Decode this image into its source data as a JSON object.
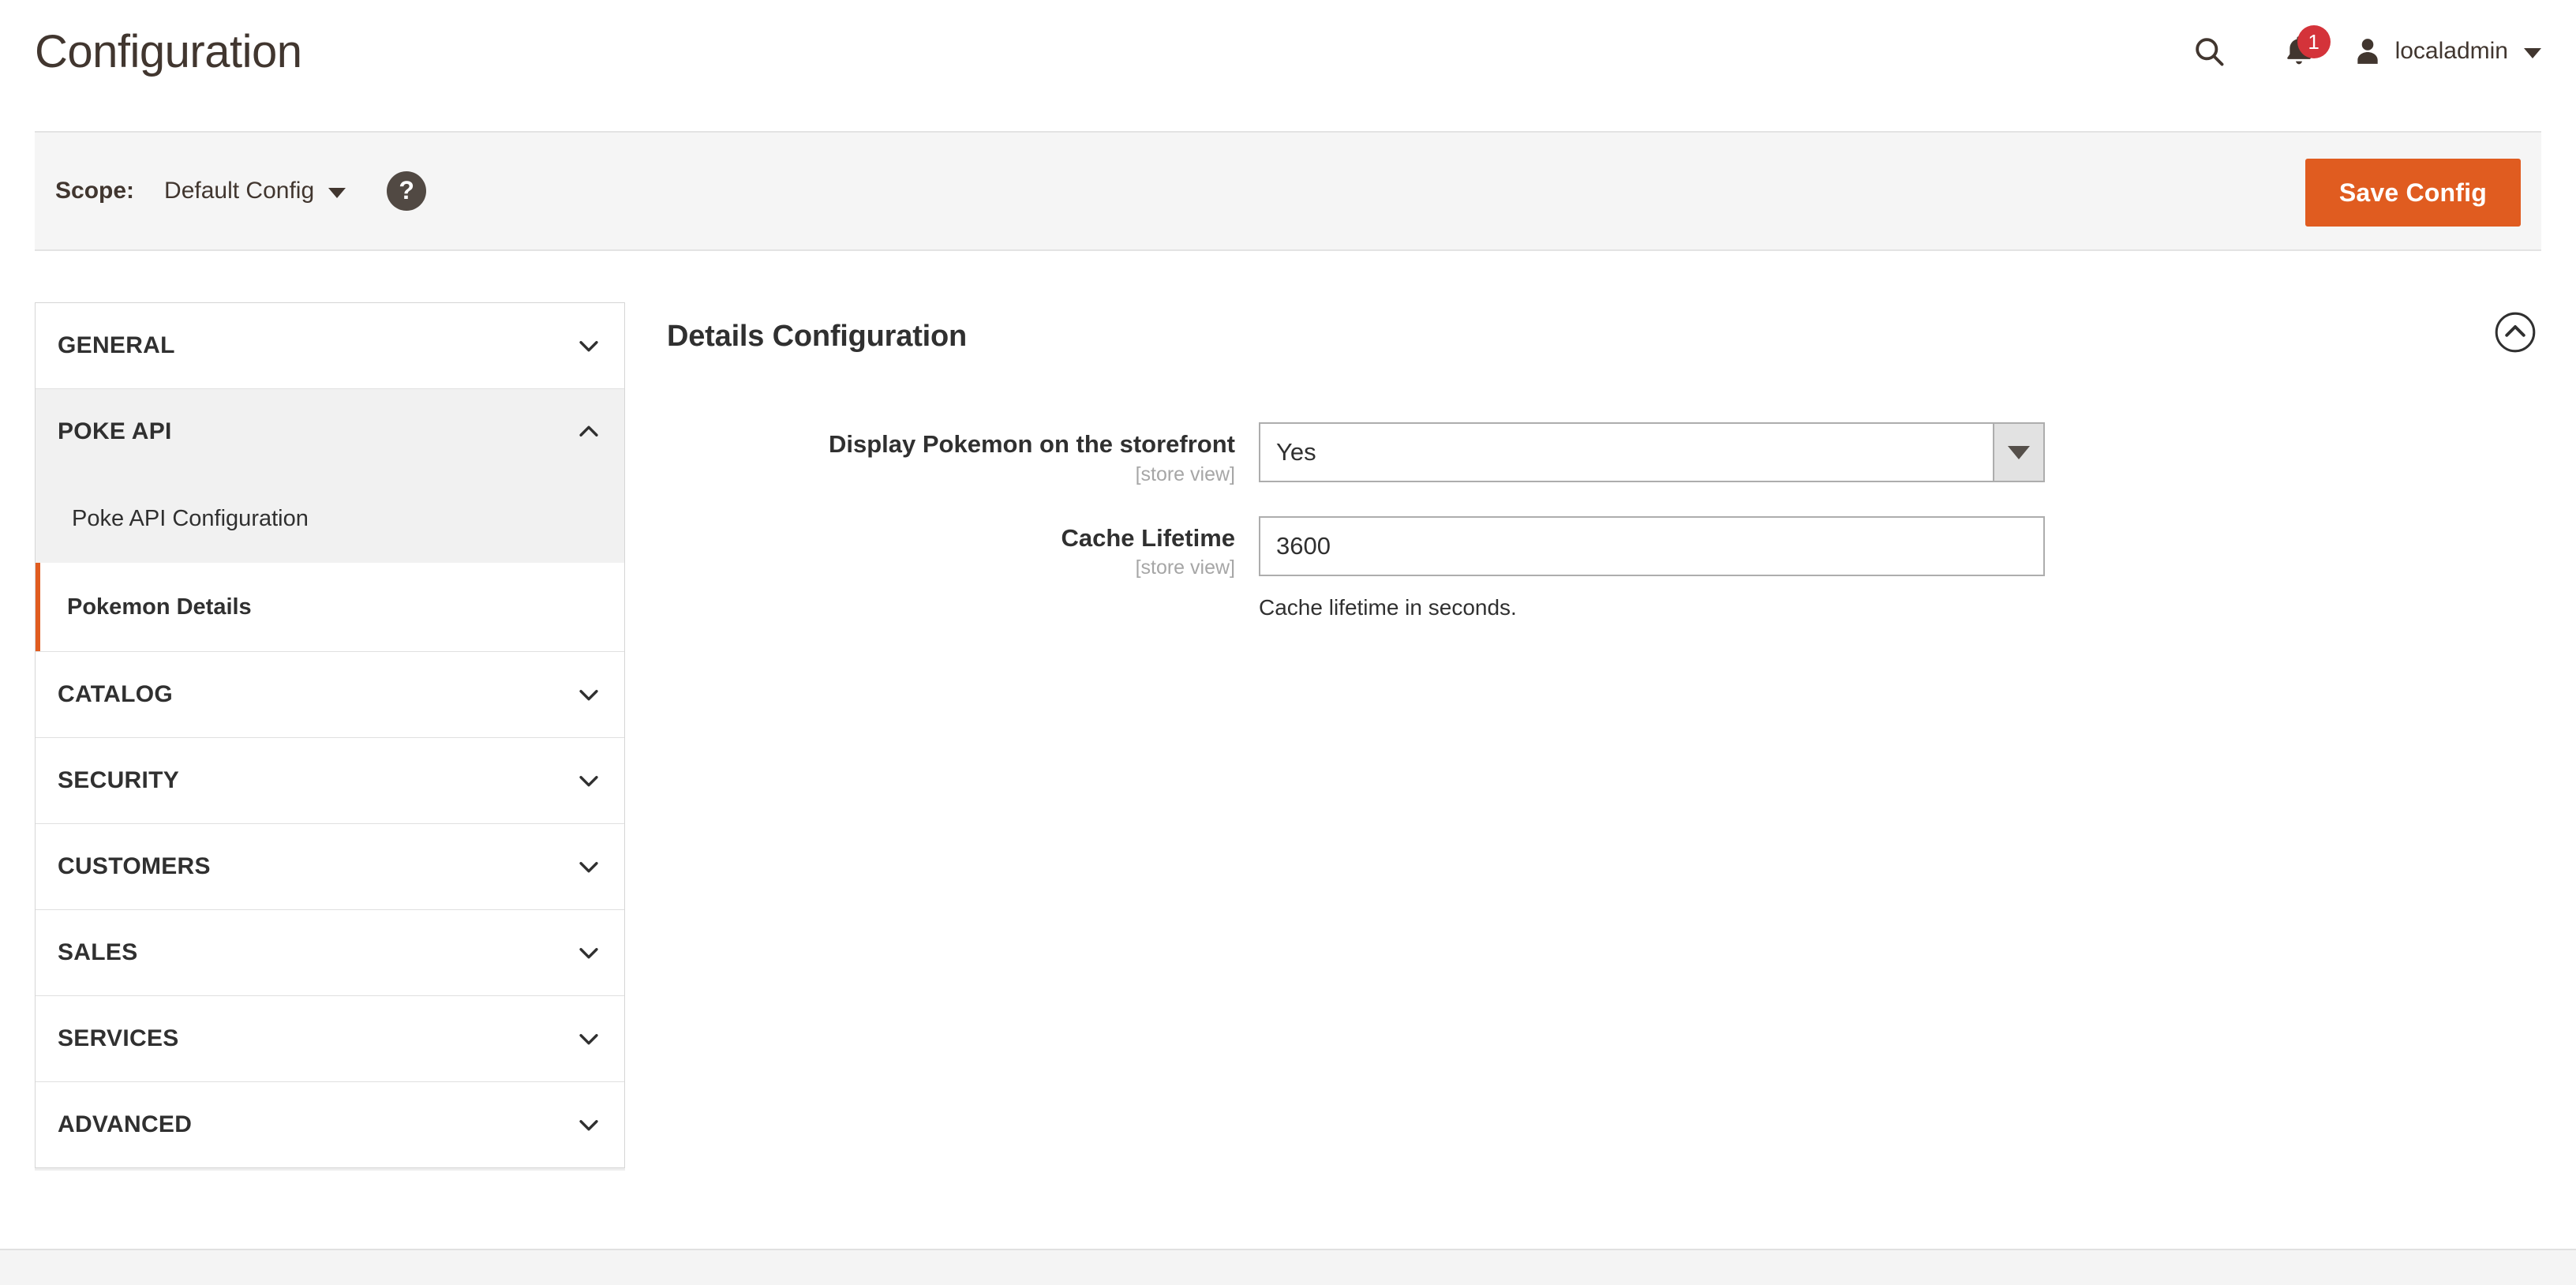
{
  "header": {
    "title": "Configuration",
    "search_icon": "search-icon",
    "notifications_icon": "bell-icon",
    "notifications_count": "1",
    "user_icon": "user-avatar-icon",
    "user_name": "localadmin",
    "user_caret_icon": "chevron-down-icon"
  },
  "scope_bar": {
    "label": "Scope:",
    "selected": "Default Config",
    "scope_caret_icon": "chevron-down-icon",
    "help_icon": "question-mark-icon",
    "help_label": "?",
    "save_label": "Save Config",
    "save_color": "#e05c20"
  },
  "sidebar": {
    "sections": [
      {
        "label": "GENERAL",
        "expanded": false,
        "chevron": "chevron-down-icon"
      },
      {
        "label": "POKE API",
        "expanded": true,
        "chevron": "chevron-up-icon",
        "subitems": [
          {
            "label": "Poke API Configuration",
            "current": false
          },
          {
            "label": "Pokemon Details",
            "current": true
          }
        ]
      },
      {
        "label": "CATALOG",
        "expanded": false,
        "chevron": "chevron-down-icon"
      },
      {
        "label": "SECURITY",
        "expanded": false,
        "chevron": "chevron-down-icon"
      },
      {
        "label": "CUSTOMERS",
        "expanded": false,
        "chevron": "chevron-down-icon"
      },
      {
        "label": "SALES",
        "expanded": false,
        "chevron": "chevron-down-icon"
      },
      {
        "label": "SERVICES",
        "expanded": false,
        "chevron": "chevron-down-icon"
      },
      {
        "label": "ADVANCED",
        "expanded": false,
        "chevron": "chevron-down-icon"
      }
    ],
    "active_accent_color": "#e05c20"
  },
  "main": {
    "section_title": "Details Configuration",
    "section_toggle_icon": "circle-chevron-up-icon",
    "fields": [
      {
        "label": "Display Pokemon on the storefront",
        "scope": "[store view]",
        "type": "select",
        "value": "Yes",
        "arrow_icon": "triangle-down-icon",
        "note": ""
      },
      {
        "label": "Cache Lifetime",
        "scope": "[store view]",
        "type": "text",
        "value": "3600",
        "note": "Cache lifetime in seconds."
      }
    ]
  }
}
